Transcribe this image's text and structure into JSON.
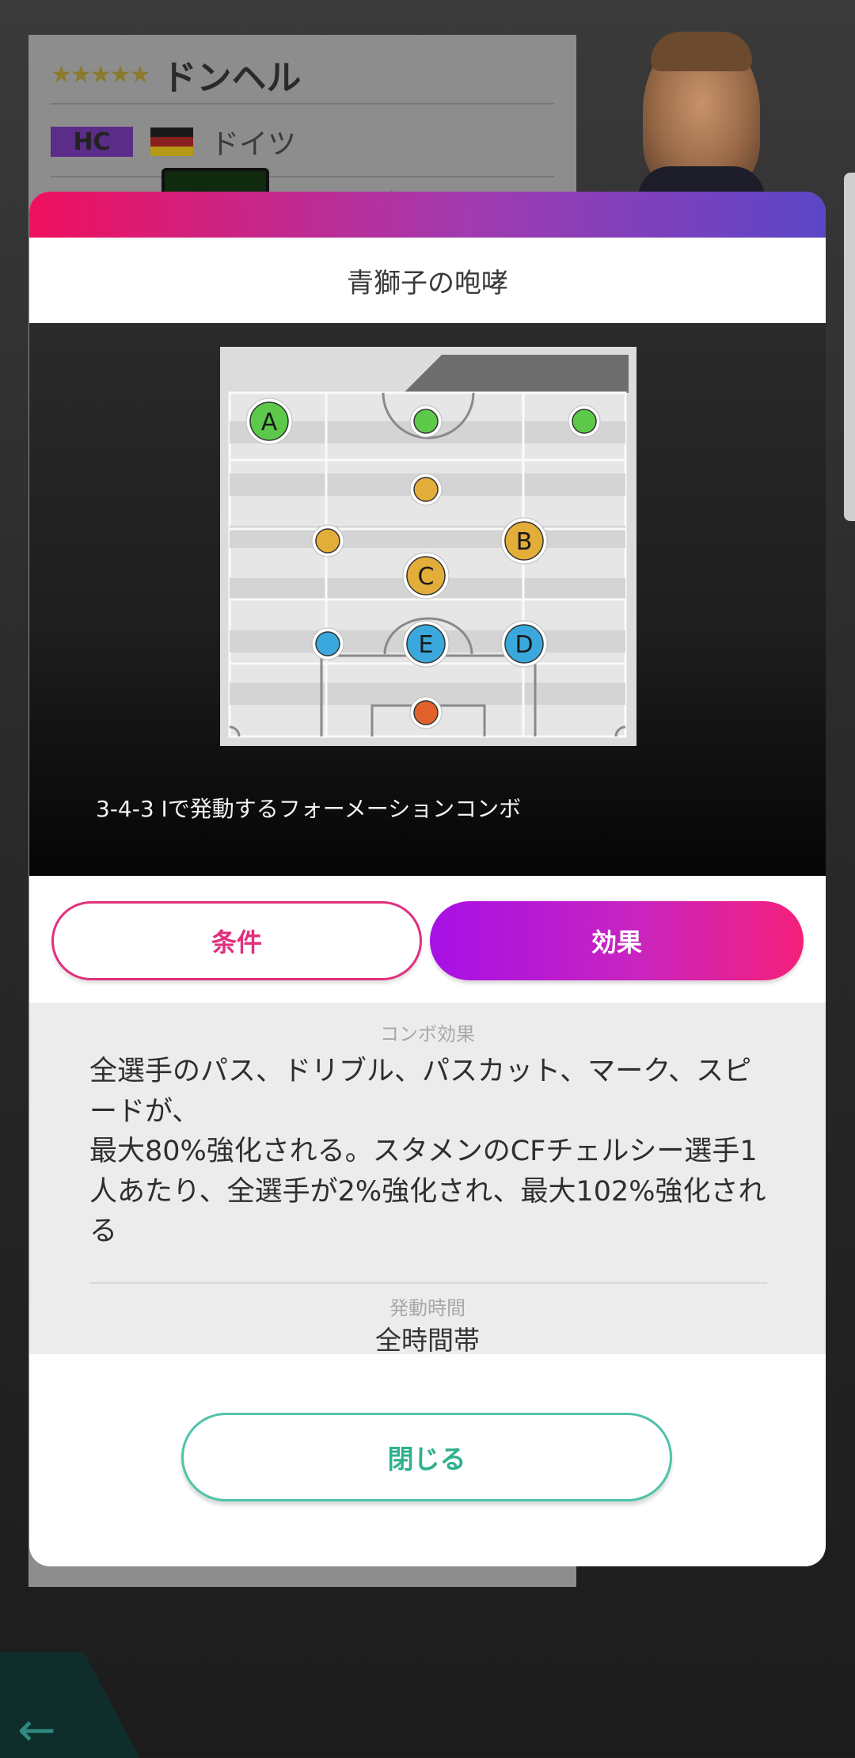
{
  "coach_card": {
    "stars": "★★★★★",
    "name": "ドンヘル",
    "position": "HC",
    "country": "ドイツ"
  },
  "modal": {
    "title": "青獅子の咆哮",
    "formation_description": "3-4-3 Iで発動するフォーメーションコンボ",
    "tabs": {
      "conditions_label": "条件",
      "effects_label": "効果",
      "active": "効果"
    },
    "effect": {
      "heading": "コンボ効果",
      "text": "全選手のパス、ドリブル、パスカット、マーク、スピードが、\n最大80%強化される。スタメンのCFチェルシー選手1人あたり、全選手が2%強化され、最大102%強化される",
      "time_heading": "発動時間",
      "time_value": "全時間帯"
    },
    "close_label": "閉じる"
  },
  "formation": {
    "players": [
      {
        "label": "A",
        "role": "forward",
        "color": "#5cc94a"
      },
      {
        "label": "",
        "role": "forward",
        "color": "#5cc94a"
      },
      {
        "label": "",
        "role": "forward",
        "color": "#5cc94a"
      },
      {
        "label": "",
        "role": "midfielder",
        "color": "#e3ad3a"
      },
      {
        "label": "",
        "role": "midfielder",
        "color": "#e3ad3a"
      },
      {
        "label": "B",
        "role": "midfielder",
        "color": "#e3ad3a"
      },
      {
        "label": "C",
        "role": "midfielder",
        "color": "#e3ad3a"
      },
      {
        "label": "",
        "role": "defender",
        "color": "#3aa8dc"
      },
      {
        "label": "E",
        "role": "defender",
        "color": "#3aa8dc"
      },
      {
        "label": "D",
        "role": "defender",
        "color": "#3aa8dc"
      },
      {
        "label": "",
        "role": "goalkeeper",
        "color": "#e0622a"
      }
    ]
  },
  "colors": {
    "header_gradient": [
      "#f0105e",
      "#5b46c7"
    ],
    "tab_active_gradient": [
      "#a710e6",
      "#f5207a"
    ],
    "tab_inactive": "#e0307e",
    "close_button": "#2fb08f"
  },
  "icons": {
    "back": "arrow-left-icon"
  }
}
